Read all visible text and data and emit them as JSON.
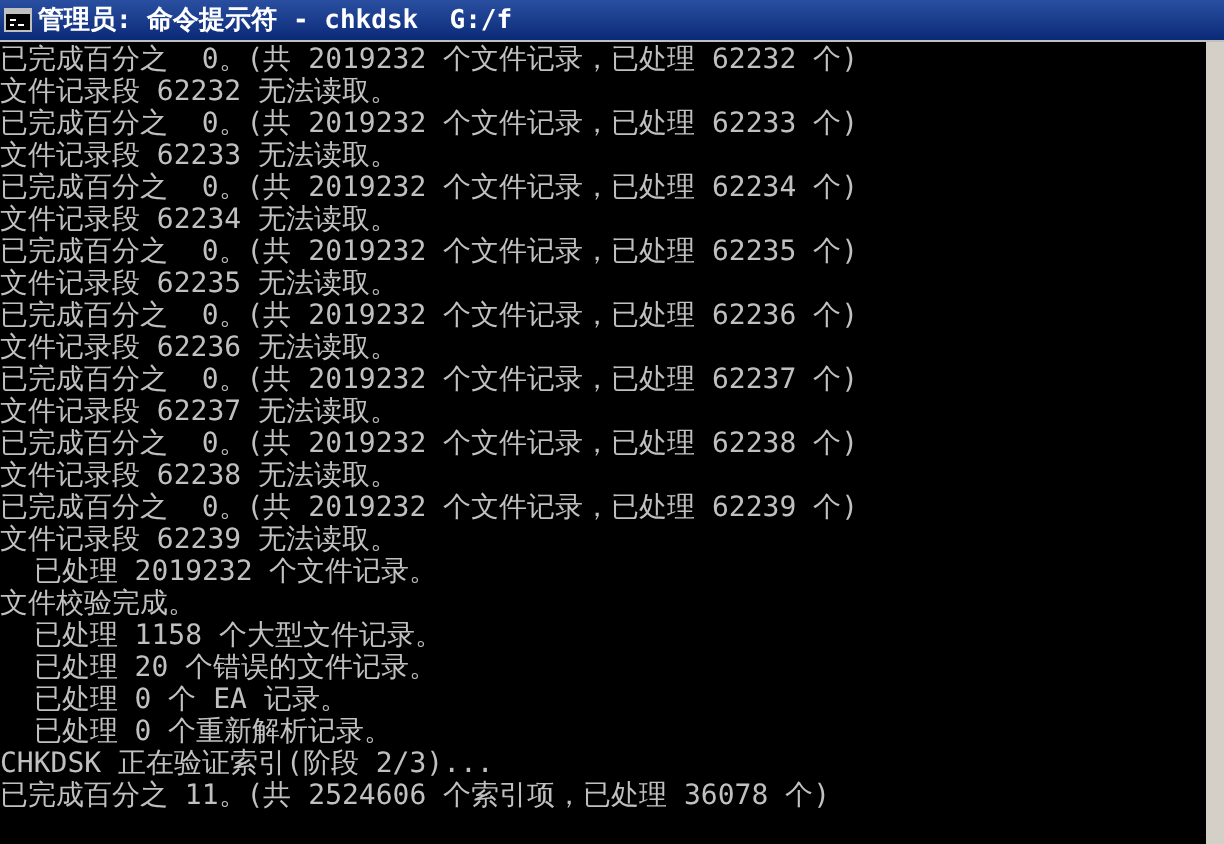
{
  "window": {
    "title": "管理员: 命令提示符 - chkdsk  G:/f"
  },
  "console_lines": [
    "已完成百分之  0。(共 2019232 个文件记录，已处理 62232 个)",
    "文件记录段 62232 无法读取。",
    "已完成百分之  0。(共 2019232 个文件记录，已处理 62233 个)",
    "文件记录段 62233 无法读取。",
    "已完成百分之  0。(共 2019232 个文件记录，已处理 62234 个)",
    "文件记录段 62234 无法读取。",
    "已完成百分之  0。(共 2019232 个文件记录，已处理 62235 个)",
    "文件记录段 62235 无法读取。",
    "已完成百分之  0。(共 2019232 个文件记录，已处理 62236 个)",
    "文件记录段 62236 无法读取。",
    "已完成百分之  0。(共 2019232 个文件记录，已处理 62237 个)",
    "文件记录段 62237 无法读取。",
    "已完成百分之  0。(共 2019232 个文件记录，已处理 62238 个)",
    "文件记录段 62238 无法读取。",
    "已完成百分之  0。(共 2019232 个文件记录，已处理 62239 个)",
    "文件记录段 62239 无法读取。",
    "  已处理 2019232 个文件记录。",
    "文件校验完成。",
    "  已处理 1158 个大型文件记录。",
    "  已处理 20 个错误的文件记录。",
    "  已处理 0 个 EA 记录。",
    "  已处理 0 个重新解析记录。",
    "CHKDSK 正在验证索引(阶段 2/3)...",
    "已完成百分之 11。(共 2524606 个索引项，已处理 36078 个)"
  ]
}
